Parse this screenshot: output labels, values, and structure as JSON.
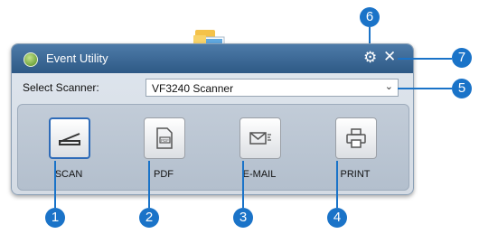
{
  "window": {
    "title": "Event Utility",
    "select_label": "Select Scanner:",
    "scanner_value": "VF3240 Scanner"
  },
  "tools": [
    {
      "label": "SCAN",
      "icon": "scanner-icon",
      "selected": true
    },
    {
      "label": "PDF",
      "icon": "pdf-icon",
      "selected": false
    },
    {
      "label": "E-MAIL",
      "icon": "email-icon",
      "selected": false
    },
    {
      "label": "PRINT",
      "icon": "printer-icon",
      "selected": false
    }
  ],
  "callouts": [
    "1",
    "2",
    "3",
    "4",
    "5",
    "6",
    "7"
  ],
  "colors": {
    "titlebar": "#3a6a99",
    "callout": "#1a73c8",
    "selected_border": "#2e6bb8"
  }
}
